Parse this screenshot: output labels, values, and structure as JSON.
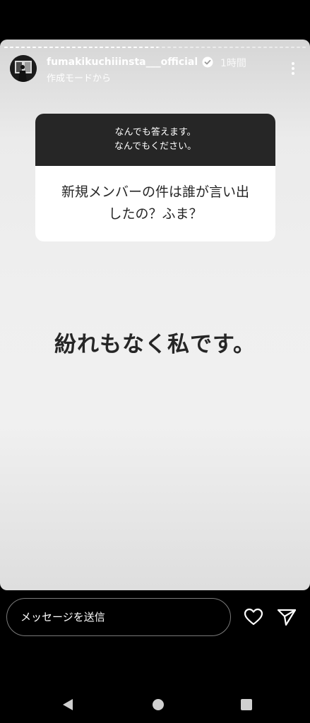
{
  "story": {
    "segments": [
      1,
      1,
      1,
      1,
      1,
      1,
      1,
      1,
      1,
      1,
      1,
      1,
      1,
      1,
      1,
      1,
      1,
      1,
      1,
      1,
      1,
      1,
      1,
      1,
      1,
      1,
      1,
      0.5,
      0,
      0,
      0,
      0,
      0,
      0,
      0,
      0,
      0,
      0,
      0,
      0,
      0,
      0,
      0,
      0,
      0,
      0,
      0,
      0,
      0,
      0,
      0,
      0,
      0,
      0
    ],
    "username": "fumakikuchiiinsta___official",
    "verified": true,
    "time": "1時間",
    "subtitle": "作成モードから",
    "icons": {
      "avatar": "profile-photo",
      "verified": "verified-badge-icon",
      "more": "more-vertical-icon"
    }
  },
  "question_card": {
    "prompt_line1": "なんでも答えます。",
    "prompt_line2": "なんでもください。",
    "question_line1": "新規メンバーの件は誰が言い出",
    "question_line2": "したの？ふま？"
  },
  "answer": "紛れもなく私です。",
  "reply": {
    "placeholder": "メッセージを送信",
    "icons": {
      "like": "heart-icon",
      "share": "send-icon"
    }
  },
  "nav": {
    "icons": [
      "back-icon",
      "home-icon",
      "recents-icon"
    ]
  },
  "colors": {
    "card_header": "#262626",
    "card_body": "#ffffff",
    "text_dark": "#262626",
    "background": "#000000"
  }
}
